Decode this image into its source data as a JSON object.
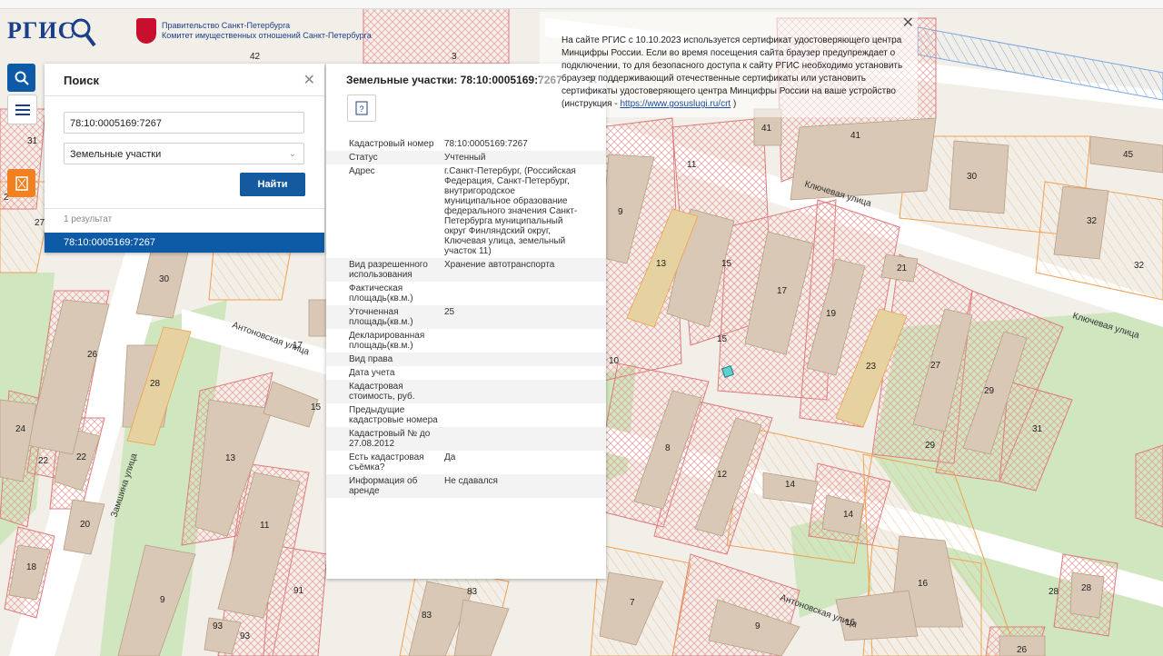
{
  "header": {
    "logo": "РГИС",
    "gov_line1": "Правительство Санкт-Петербурга",
    "gov_line2": "Комитет имущественных отношений Санкт-Петербурга"
  },
  "search_panel": {
    "title": "Поиск",
    "query_value": "78:10:0005169:7267",
    "type_value": "Земельные участки",
    "find_label": "Найти",
    "results_count": "1 результат",
    "result_item": "78:10:0005169:7267"
  },
  "info_panel": {
    "title": "Земельные участки: 78:10:0005169:7267",
    "rows": [
      {
        "k": "Кадастровый номер",
        "v": "78:10:0005169:7267"
      },
      {
        "k": "Статус",
        "v": "Учтенный"
      },
      {
        "k": "Адрес",
        "v": "г.Санкт-Петербург, (Российская Федерация, Санкт-Петербург, внутригородское муниципальное образование федерального значения Санкт-Петербурга муниципальный округ Финляндский округ, Ключевая улица, земельный участок 11)"
      },
      {
        "k": "Вид разрешенного использования",
        "v": "Хранение автотранспорта"
      },
      {
        "k": "Фактическая площадь(кв.м.)",
        "v": ""
      },
      {
        "k": "Уточненная площадь(кв.м.)",
        "v": "25"
      },
      {
        "k": "Декларированная площадь(кв.м.)",
        "v": ""
      },
      {
        "k": "Вид права",
        "v": ""
      },
      {
        "k": "Дата учета",
        "v": ""
      },
      {
        "k": "Кадастровая стоимость, руб.",
        "v": ""
      },
      {
        "k": "Предыдущие кадастровые номера",
        "v": ""
      },
      {
        "k": "Кадастровый № до 27.08.2012",
        "v": ""
      },
      {
        "k": "Есть кадастровая съёмка?",
        "v": "Да"
      },
      {
        "k": "Информация об аренде",
        "v": "Не сдавался"
      }
    ]
  },
  "notice": {
    "text": "На сайте РГИС с 10.10.2023 используется сертификат удостоверяющего центра Минцифры России. Если во время посещения сайта браузер предупреждает о подключении, то для безопасного доступа к сайту РГИС необходимо установить браузер поддерживающий отечественные сертификаты или установить сертификаты удостоверяющего центра Минцифры России на ваше устройство (инструкция - ",
    "link": "https://www.gosuslugi.ru/crt",
    "tail": " )"
  },
  "map": {
    "streets": [
      "Ключевая улица",
      "Ключевая улица",
      "Антоновская улица",
      "Антоновская улица",
      "Замшина улица"
    ],
    "labels": [
      "42",
      "3",
      "31",
      "27",
      "2",
      "30",
      "26",
      "17",
      "28",
      "15",
      "24",
      "22",
      "22",
      "20",
      "18",
      "13",
      "11",
      "9",
      "93",
      "93",
      "91",
      "83",
      "83",
      "7",
      "9",
      "13",
      "15",
      "17",
      "19",
      "9",
      "11",
      "41",
      "41",
      "30",
      "45",
      "32",
      "32",
      "21",
      "15",
      "10",
      "8",
      "12",
      "23",
      "27",
      "29",
      "29",
      "31",
      "14",
      "14",
      "16",
      "16",
      "28",
      "28",
      "26"
    ]
  },
  "colors": {
    "accent": "#0d5aa7",
    "parcel_stroke": "#e07a7a",
    "building": "#d9c8b6",
    "green": "#cfe6bf"
  }
}
